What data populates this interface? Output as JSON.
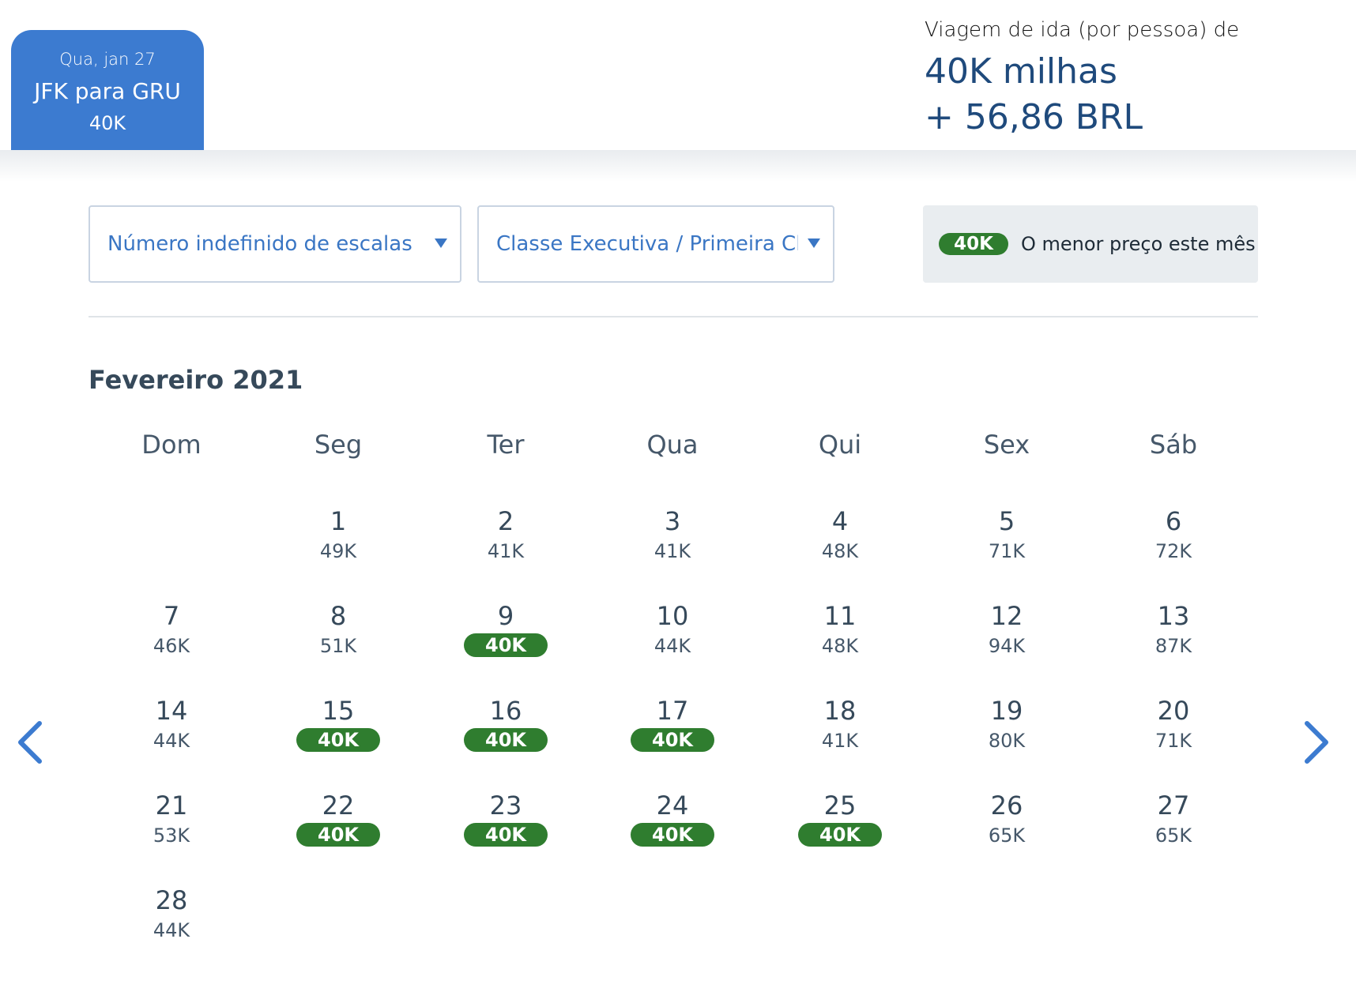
{
  "header": {
    "tab": {
      "date": "Qua, jan 27",
      "route": "JFK para GRU",
      "miles": "40K"
    },
    "price": {
      "label": "Viagem de ida (por pessoa) de",
      "miles": "40K milhas",
      "cash": "+ 56,86 BRL"
    }
  },
  "filters": {
    "stops": {
      "value": "Número indefinido de escalas"
    },
    "cabin": {
      "value": "Classe Executiva / Primeira Classe"
    }
  },
  "legend": {
    "badge": "40K",
    "text": "O menor preço este mês"
  },
  "calendar": {
    "month": "Fevereiro 2021",
    "weekdays": [
      "Dom",
      "Seg",
      "Ter",
      "Qua",
      "Qui",
      "Sex",
      "Sáb"
    ],
    "first_weekday_index": 1,
    "days": [
      {
        "day": "1",
        "price": "49K",
        "lowest": false
      },
      {
        "day": "2",
        "price": "41K",
        "lowest": false
      },
      {
        "day": "3",
        "price": "41K",
        "lowest": false
      },
      {
        "day": "4",
        "price": "48K",
        "lowest": false
      },
      {
        "day": "5",
        "price": "71K",
        "lowest": false
      },
      {
        "day": "6",
        "price": "72K",
        "lowest": false
      },
      {
        "day": "7",
        "price": "46K",
        "lowest": false
      },
      {
        "day": "8",
        "price": "51K",
        "lowest": false
      },
      {
        "day": "9",
        "price": "40K",
        "lowest": true
      },
      {
        "day": "10",
        "price": "44K",
        "lowest": false
      },
      {
        "day": "11",
        "price": "48K",
        "lowest": false
      },
      {
        "day": "12",
        "price": "94K",
        "lowest": false
      },
      {
        "day": "13",
        "price": "87K",
        "lowest": false
      },
      {
        "day": "14",
        "price": "44K",
        "lowest": false
      },
      {
        "day": "15",
        "price": "40K",
        "lowest": true
      },
      {
        "day": "16",
        "price": "40K",
        "lowest": true
      },
      {
        "day": "17",
        "price": "40K",
        "lowest": true
      },
      {
        "day": "18",
        "price": "41K",
        "lowest": false
      },
      {
        "day": "19",
        "price": "80K",
        "lowest": false
      },
      {
        "day": "20",
        "price": "71K",
        "lowest": false
      },
      {
        "day": "21",
        "price": "53K",
        "lowest": false
      },
      {
        "day": "22",
        "price": "40K",
        "lowest": true
      },
      {
        "day": "23",
        "price": "40K",
        "lowest": true
      },
      {
        "day": "24",
        "price": "40K",
        "lowest": true
      },
      {
        "day": "25",
        "price": "40K",
        "lowest": true
      },
      {
        "day": "26",
        "price": "65K",
        "lowest": false
      },
      {
        "day": "27",
        "price": "65K",
        "lowest": false
      },
      {
        "day": "28",
        "price": "44K",
        "lowest": false
      }
    ]
  },
  "icons": {
    "prev": "chevron-left-icon",
    "next": "chevron-right-icon",
    "dropdown": "caret-down-icon"
  },
  "colors": {
    "accent": "#3c7bd0",
    "lowest": "#2f7d2f",
    "price_text": "#1f4a7c"
  }
}
